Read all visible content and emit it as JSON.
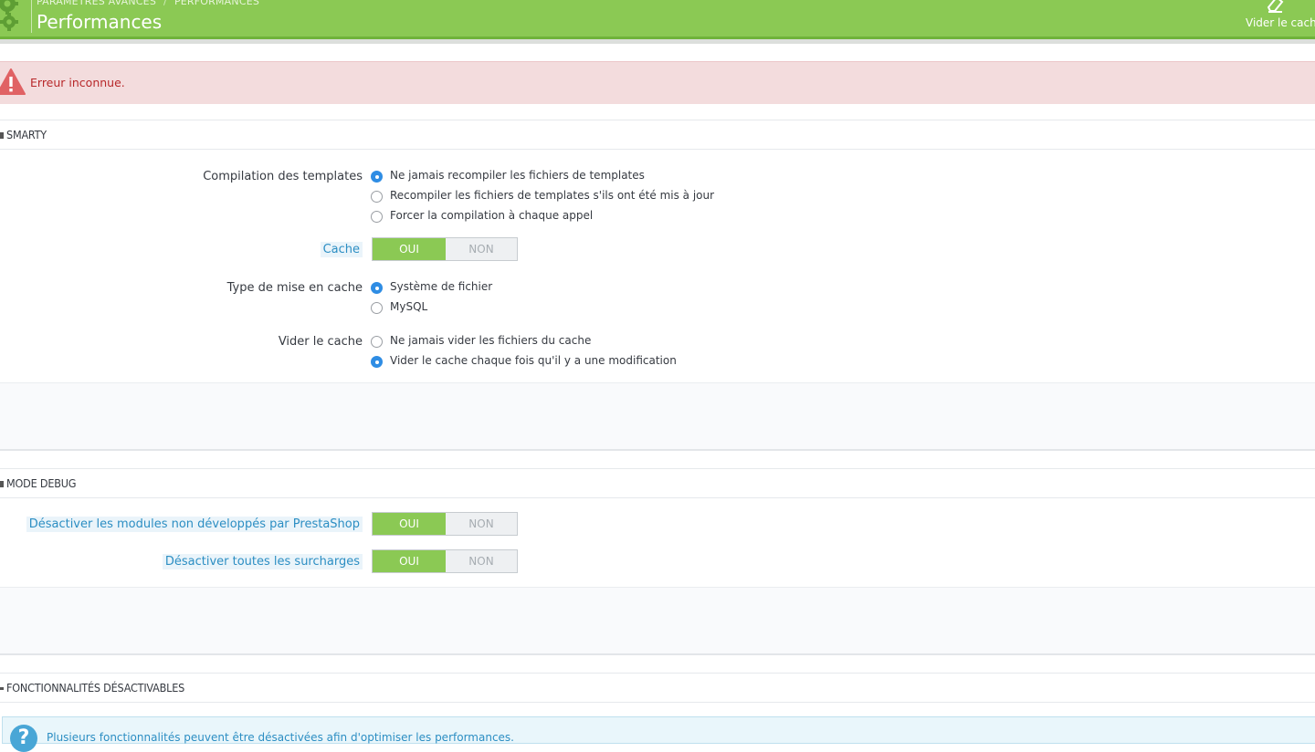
{
  "header": {
    "breadcrumb": [
      "PARAMÈTRES AVANCÉS",
      "PERFORMANCES"
    ],
    "breadcrumb_separator": "/",
    "title": "Performances",
    "clear_cache_label": "Vider le cache",
    "gear_icon": "gears-icon",
    "eraser_icon": "eraser-icon",
    "bar_color": "#8bc954"
  },
  "alert": {
    "message": "Erreur inconnue.",
    "icon": "warning-triangle-icon",
    "color": "#b8282a"
  },
  "smarty": {
    "heading": "SMARTY",
    "compilation": {
      "label": "Compilation des templates",
      "options": [
        {
          "label": "Ne jamais recompiler les fichiers de templates",
          "checked": true
        },
        {
          "label": "Recompiler les fichiers de templates s'ils ont été mis à jour",
          "checked": false
        },
        {
          "label": "Forcer la compilation à chaque appel",
          "checked": false
        }
      ]
    },
    "cache": {
      "label": "Cache",
      "on": "OUI",
      "off": "NON",
      "value": "OUI"
    },
    "cache_type": {
      "label": "Type de mise en cache",
      "options": [
        {
          "label": "Système de fichier",
          "checked": true
        },
        {
          "label": "MySQL",
          "checked": false
        }
      ]
    },
    "clear_cache": {
      "label": "Vider le cache",
      "options": [
        {
          "label": "Ne jamais vider les fichiers du cache",
          "checked": false
        },
        {
          "label": "Vider le cache chaque fois qu'il y a une modification",
          "checked": true
        }
      ]
    }
  },
  "debug": {
    "heading": "MODE DEBUG",
    "disable_non_native": {
      "label": "Désactiver les modules non développés par PrestaShop",
      "on": "OUI",
      "off": "NON",
      "value": "OUI"
    },
    "disable_overrides": {
      "label": "Désactiver toutes les surcharges",
      "on": "OUI",
      "off": "NON",
      "value": "OUI"
    }
  },
  "features": {
    "heading": "FONCTIONNALITÉS DÉSACTIVABLES",
    "info": "Plusieurs fonctionnalités peuvent être désactivées afin d'optimiser les performances.",
    "info_icon": "question-icon"
  },
  "colors": {
    "accent_green": "#8bc954",
    "radio_blue": "#2f8de4",
    "help_blue": "#2c8ec3",
    "alert_bg": "#f3dcdd"
  }
}
